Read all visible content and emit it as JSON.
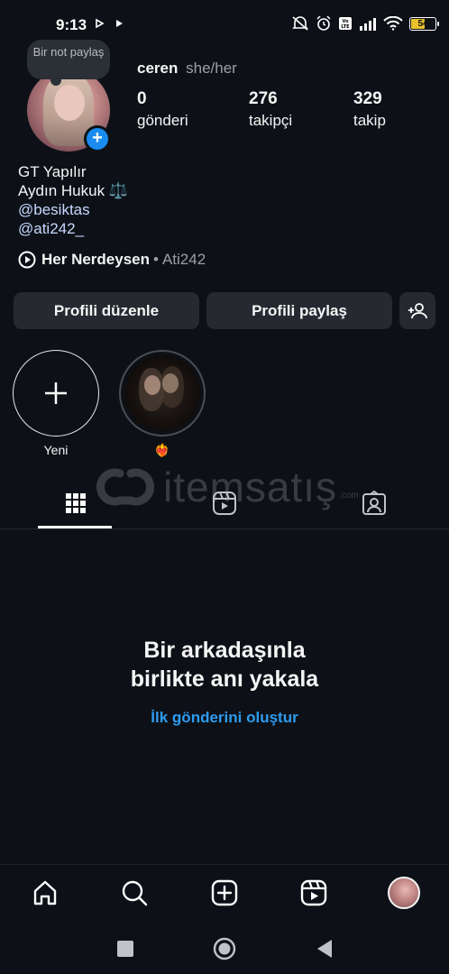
{
  "status_bar": {
    "time": "9:13",
    "battery": "54"
  },
  "profile": {
    "note_placeholder": "Bir not paylaş",
    "username": "ceren",
    "pronouns": "she/her",
    "stats": [
      {
        "value": "0",
        "label": "gönderi"
      },
      {
        "value": "276",
        "label": "takipçi"
      },
      {
        "value": "329",
        "label": "takip"
      }
    ],
    "bio": {
      "line1": "GT Yapılır",
      "line2": "Aydın Hukuk ⚖️",
      "mention1": "@besiktas",
      "mention2": "@ati242_"
    },
    "music": {
      "title": "Her Nerdeysen",
      "separator": "•",
      "artist": "Ati242"
    }
  },
  "actions": {
    "edit_profile": "Profili düzenle",
    "share_profile": "Profili paylaş"
  },
  "highlights": [
    {
      "label": "Yeni"
    },
    {
      "label": "❤️‍🔥"
    }
  ],
  "watermark": {
    "text": "itemsatış",
    "suffix": ".com"
  },
  "tabs": [
    {
      "name": "grid",
      "icon": "grid-icon",
      "active": true
    },
    {
      "name": "reels",
      "icon": "reels-icon",
      "active": false
    },
    {
      "name": "tagged",
      "icon": "tagged-icon",
      "active": false
    }
  ],
  "empty_state": {
    "title_line1": "Bir arkadaşınla",
    "title_line2": "birlikte anı yakala",
    "cta": "İlk gönderini oluştur"
  },
  "bottom_nav": [
    "home-icon",
    "search-icon",
    "create-icon",
    "reels-icon",
    "profile-avatar"
  ],
  "colors": {
    "background": "#0d1117",
    "button": "#262a30",
    "accent_blue": "#2e9bf0",
    "battery": "#e8c12b"
  }
}
